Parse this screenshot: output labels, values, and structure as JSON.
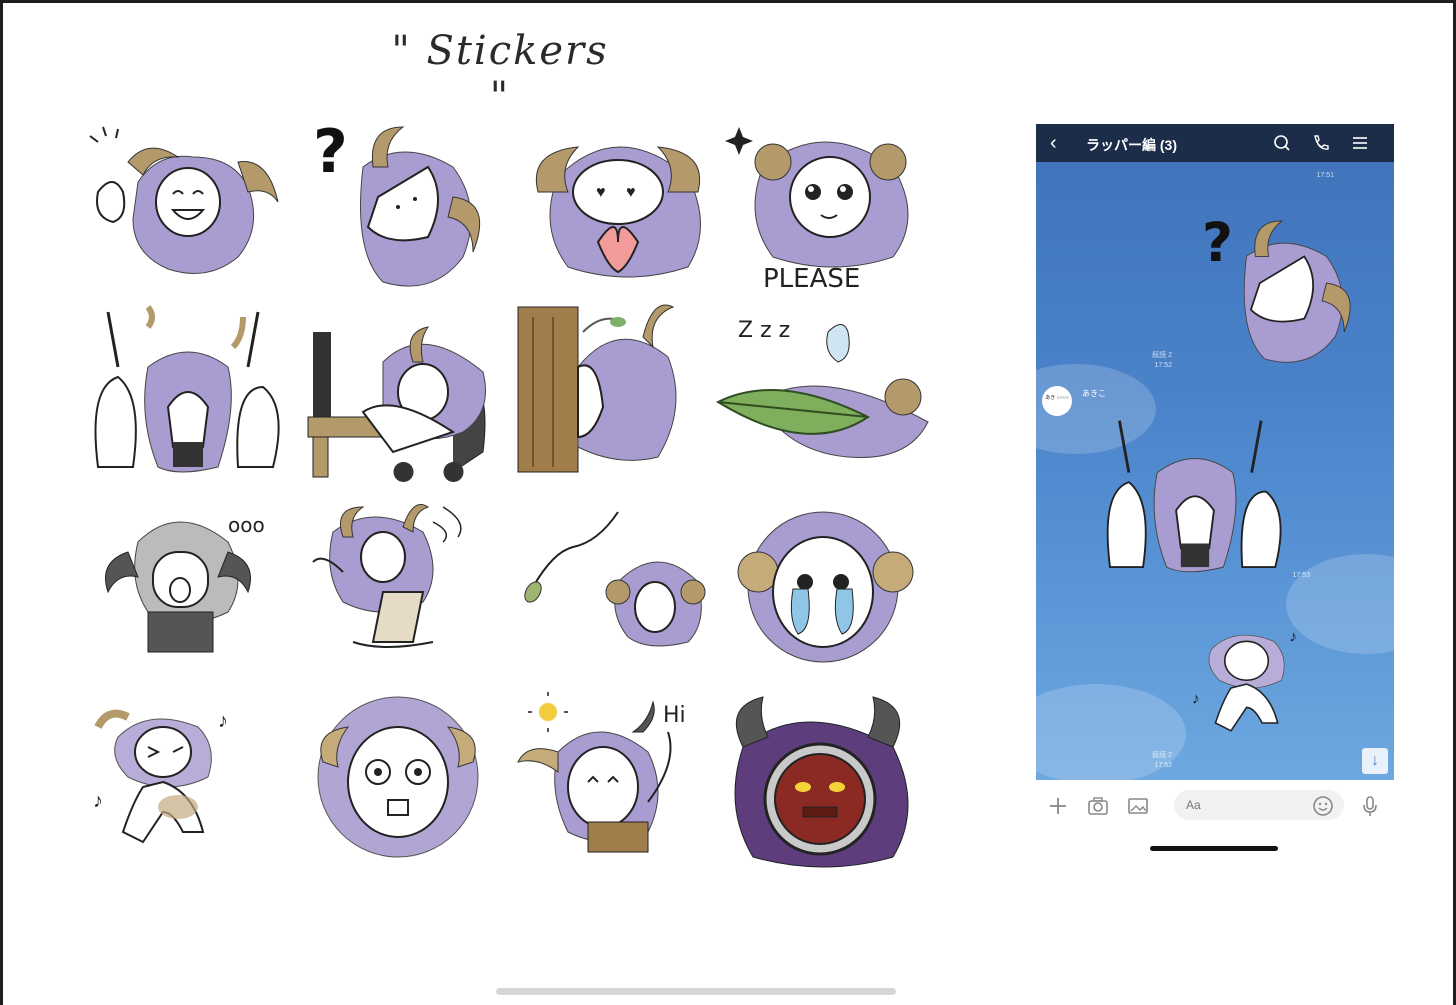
{
  "sheet": {
    "title": "\" Stickers \"",
    "stickers": [
      {
        "id": "laughing",
        "caption": ""
      },
      {
        "id": "confused",
        "caption": ""
      },
      {
        "id": "heart",
        "caption": ""
      },
      {
        "id": "please",
        "caption": "PLEASE"
      },
      {
        "id": "commute",
        "caption": ""
      },
      {
        "id": "desk-nap",
        "caption": ""
      },
      {
        "id": "peek-tree",
        "caption": ""
      },
      {
        "id": "sleeping",
        "caption": "Z z z"
      },
      {
        "id": "thinking",
        "caption": "ooo"
      },
      {
        "id": "stretch",
        "caption": ""
      },
      {
        "id": "falling-leaf",
        "caption": ""
      },
      {
        "id": "crying",
        "caption": ""
      },
      {
        "id": "dancing",
        "caption": ""
      },
      {
        "id": "shocked",
        "caption": ""
      },
      {
        "id": "hi",
        "caption": "Hi"
      },
      {
        "id": "angry-mask",
        "caption": ""
      }
    ]
  },
  "chat": {
    "header": {
      "back_icon": "chevron-left-icon",
      "title": "ラッパー編 (3)",
      "icons": [
        "search-icon",
        "phone-icon",
        "menu-icon"
      ]
    },
    "messages": [
      {
        "time": "17:51"
      },
      {
        "read": "既読 2",
        "time": "17:52"
      },
      {
        "sender": "あきこ",
        "avatar_text": "あき ○○○○"
      },
      {
        "time": "17:53"
      },
      {
        "read": "既読 2",
        "time": "17:52"
      }
    ],
    "input": {
      "placeholder": "Aa",
      "icons": [
        "plus-icon",
        "camera-icon",
        "image-icon",
        "emoji-icon",
        "mic-icon"
      ]
    },
    "scroll_icon": "arrow-down-icon"
  },
  "colors": {
    "fur": "#9f93c4",
    "horn": "#b49a6a",
    "chat_bg": "#4a82c9",
    "header": "#1c2d4a"
  }
}
